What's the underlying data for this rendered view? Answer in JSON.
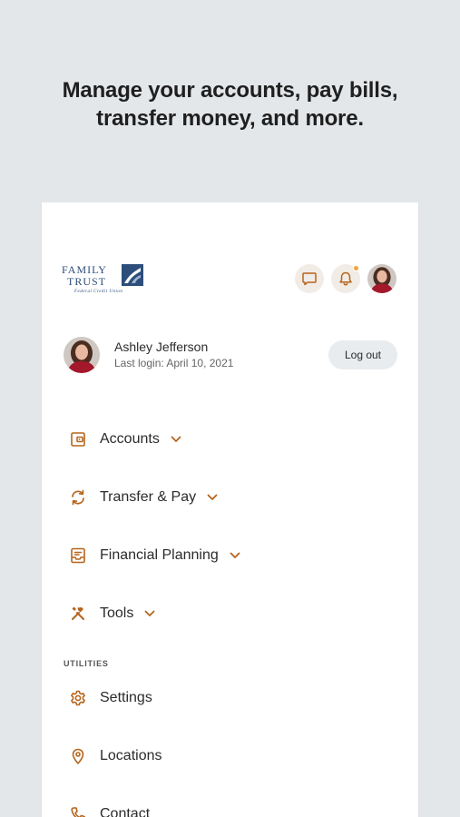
{
  "headline": {
    "line1": "Manage your accounts, pay bills,",
    "line2": "transfer money, and more."
  },
  "logo": {
    "line1": "FAMILY",
    "line2": "TRUST",
    "sub": "Federal Credit Union"
  },
  "user": {
    "name": "Ashley Jefferson",
    "last_login": "Last login: April 10, 2021",
    "logout_label": "Log out"
  },
  "nav": {
    "items": [
      {
        "label": "Accounts",
        "icon": "wallet-icon"
      },
      {
        "label": "Transfer & Pay",
        "icon": "transfer-icon"
      },
      {
        "label": "Financial Planning",
        "icon": "planning-icon"
      },
      {
        "label": "Tools",
        "icon": "tools-icon"
      }
    ],
    "section_label": "UTILITIES",
    "utilities": [
      {
        "label": "Settings",
        "icon": "gear-icon"
      },
      {
        "label": "Locations",
        "icon": "location-pin-icon"
      },
      {
        "label": "Contact",
        "icon": "phone-icon"
      }
    ]
  },
  "colors": {
    "accent": "#b5651d",
    "logo_blue": "#2d4d7a",
    "notification_dot": "#f2a43a",
    "background": "#e4e7ea"
  }
}
